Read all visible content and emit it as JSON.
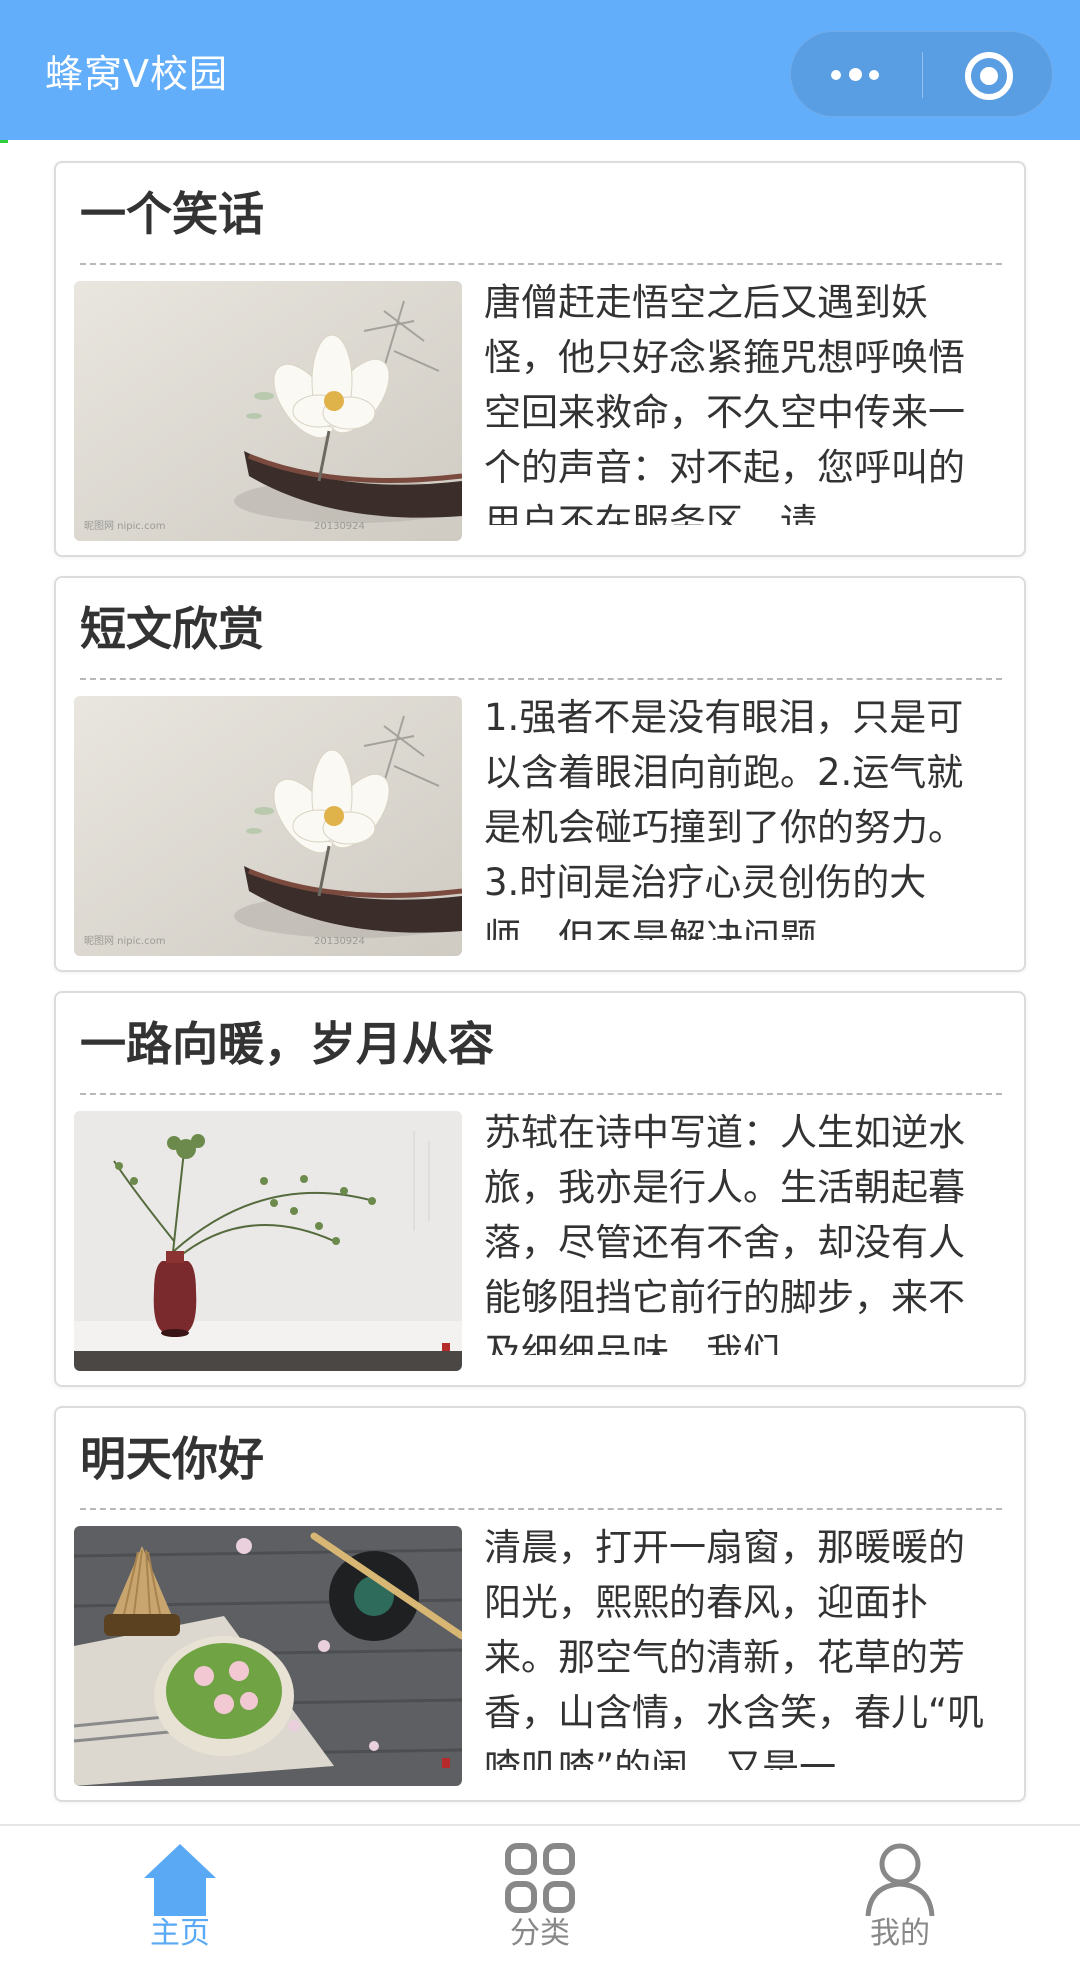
{
  "app": {
    "title": "蜂窝V校园"
  },
  "colors": {
    "header_bg": "#62aefb",
    "accent": "#5aa9f5",
    "inactive": "#888888",
    "text": "#333333"
  },
  "capsule": {
    "more_icon": "more-dots-icon",
    "close_icon": "target-circle-icon"
  },
  "articles": [
    {
      "title": "一个笑话",
      "summary": "唐僧赶走悟空之后又遇到妖怪，他只好念紧箍咒想呼唤悟空回来救命，不久空中传来一个的声音：对不起，您呼叫的用户不在服务区，请",
      "image": "lotus-boat-painting"
    },
    {
      "title": "短文欣赏",
      "summary": "1.强者不是没有眼泪，只是可以含着眼泪向前跑。2.运气就是机会碰巧撞到了你的努力。3.时间是治疗心灵创伤的大师，但不是解决问题",
      "image": "lotus-boat-painting"
    },
    {
      "title": "一路向暖，岁月从容",
      "summary": "苏轼在诗中写道：人生如逆水旅，我亦是行人。生活朝起暮落，尽管还有不舍，却没有人能够阻挡它前行的脚步，来不及细细品味，我们",
      "image": "vase-with-branches"
    },
    {
      "title": "明天你好",
      "summary": "清晨，打开一扇窗，那暖暖的阳光，熙熙的春风，迎面扑来。那空气的清新，花草的芳香，山含情，水含笑，春儿“叽喳叽喳”的闹，又是一",
      "image": "matcha-tea-table"
    }
  ],
  "tabbar": {
    "items": [
      {
        "label": "主页",
        "icon": "home-icon",
        "active": true
      },
      {
        "label": "分类",
        "icon": "grid-icon",
        "active": false
      },
      {
        "label": "我的",
        "icon": "user-icon",
        "active": false
      }
    ]
  }
}
